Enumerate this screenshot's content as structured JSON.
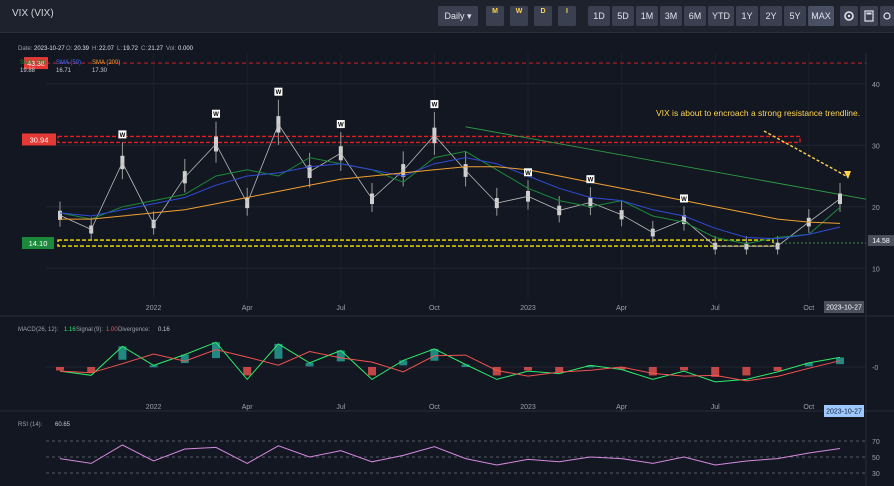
{
  "header": {
    "title": "VIX (VIX)",
    "interval_label": "Daily",
    "timeframe_icons": [
      "M",
      "W",
      "D",
      "I"
    ],
    "ranges": [
      "1D",
      "5D",
      "1M",
      "3M",
      "6M",
      "YTD",
      "1Y",
      "2Y",
      "5Y",
      "MAX"
    ],
    "active_range": "MAX",
    "tool_icons": [
      "settings-icon",
      "calculator-icon",
      "more-icon"
    ]
  },
  "info_line": {
    "date_label": "Date:",
    "date": "2023-10-27",
    "o_label": "O:",
    "o": "20.39",
    "h_label": "H:",
    "h": "22.07",
    "l_label": "L:",
    "l": "19.72",
    "c_label": "C:",
    "c": "21.27",
    "vol_label": "Vol:",
    "vol": "0.000"
  },
  "sma_legend": [
    {
      "label": "SMA (20)",
      "value": "19.88",
      "color": "#1b8a3a"
    },
    {
      "label": "SMA (50)",
      "value": "16.71",
      "color": "#2f4bd8"
    },
    {
      "label": "SMA (200)",
      "value": "17.30",
      "color": "#f0a030"
    }
  ],
  "annotation": "VIX is about to encroach a strong resistance trendline.",
  "level_tags": {
    "top_red": "43.36",
    "resistance": "30.94",
    "support": "14.10",
    "last": "14.58"
  },
  "date_tag": "2023-10-27",
  "macd": {
    "label": "MACD",
    "params": "(26, 12):",
    "value": "1.16",
    "signal_label": "Signal",
    "signal_params": "(9):",
    "signal_value": "1.00",
    "div_label": "Divergence:",
    "div_value": "0.16"
  },
  "rsi": {
    "label": "RSI",
    "params": "(14):",
    "value": "60.65"
  },
  "marker_letter": "W",
  "colors": {
    "up": "#26a69a",
    "down": "#ef5350",
    "accent_yellow": "#ffd54f",
    "resistance_red": "#e02020",
    "support_yellow": "#f5e50a"
  },
  "chart_data": {
    "type": "line",
    "title": "VIX (VIX)",
    "x": [
      "2021-09",
      "2021-10",
      "2021-11",
      "2021-12",
      "2022-01",
      "2022-02",
      "2022-03",
      "2022-04",
      "2022-05",
      "2022-06",
      "2022-07",
      "2022-08",
      "2022-09",
      "2022-10",
      "2022-11",
      "2022-12",
      "2023-01",
      "2023-02",
      "2023-03",
      "2023-04",
      "2023-05",
      "2023-06",
      "2023-07",
      "2023-08",
      "2023-09",
      "2023-10"
    ],
    "x_tick_labels": [
      "2022",
      "Apr",
      "Jul",
      "Oct",
      "2023",
      "Apr",
      "Jul",
      "Oct"
    ],
    "series": [
      {
        "name": "VIX",
        "values": [
          18.6,
          16.3,
          27.2,
          17.2,
          24.8,
          30.2,
          20.6,
          33.4,
          25.7,
          28.7,
          21.3,
          25.9,
          31.6,
          25.9,
          20.6,
          21.7,
          19.4,
          20.7,
          18.7,
          15.8,
          17.9,
          13.6,
          13.6,
          13.6,
          17.5,
          21.3
        ]
      },
      {
        "name": "SMA (20)",
        "values": [
          19.0,
          18.0,
          20.0,
          21.0,
          22.0,
          25.0,
          26.0,
          25.0,
          28.0,
          27.0,
          26.0,
          24.0,
          28.0,
          29.0,
          26.0,
          23.0,
          21.0,
          20.0,
          21.0,
          18.5,
          17.5,
          15.0,
          14.0,
          15.0,
          15.5,
          19.9
        ]
      },
      {
        "name": "SMA (50)",
        "values": [
          19.0,
          18.5,
          19.5,
          20.5,
          21.5,
          23.5,
          25.0,
          25.5,
          26.5,
          27.0,
          26.0,
          25.0,
          27.0,
          28.0,
          27.0,
          25.0,
          23.0,
          21.5,
          21.0,
          19.5,
          18.5,
          16.5,
          15.0,
          14.8,
          15.5,
          16.7
        ]
      },
      {
        "name": "SMA (200)",
        "values": [
          18.0,
          18.0,
          18.5,
          19.0,
          19.5,
          20.5,
          21.5,
          22.5,
          23.5,
          24.5,
          25.0,
          25.5,
          26.0,
          26.5,
          26.5,
          26.0,
          25.0,
          24.0,
          23.0,
          22.0,
          21.0,
          20.0,
          19.0,
          18.0,
          17.5,
          17.3
        ]
      }
    ],
    "y_ticks": [
      10,
      20,
      30,
      40
    ],
    "ylim": [
      5,
      45
    ],
    "resistance_level": 30.94,
    "support_level": 14.1,
    "top_level": 43.36,
    "trendline": [
      {
        "x": "2022-10",
        "y": 33
      },
      {
        "x": "2023-10",
        "y": 22
      }
    ],
    "macd_values": [
      -0.5,
      -1.0,
      2.5,
      0.2,
      1.5,
      3.0,
      -1.5,
      2.8,
      0.5,
      2.0,
      -1.5,
      0.8,
      2.2,
      0.3,
      -1.5,
      -0.5,
      -0.8,
      0.2,
      -0.3,
      -1.5,
      -0.5,
      -1.8,
      -1.5,
      -0.6,
      0.5,
      1.16
    ],
    "rsi_values": [
      48,
      42,
      65,
      45,
      60,
      62,
      42,
      64,
      50,
      58,
      44,
      52,
      63,
      48,
      40,
      47,
      44,
      50,
      48,
      42,
      50,
      40,
      45,
      48,
      55,
      60.65
    ],
    "rsi_ticks": [
      30,
      50,
      70
    ],
    "macd_ticks": [
      0
    ],
    "grid": true
  }
}
